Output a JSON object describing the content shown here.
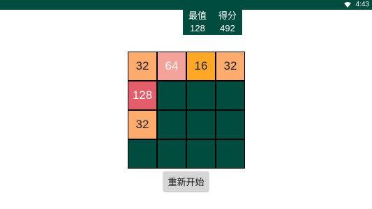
{
  "status_bar": {
    "time": "4:43",
    "icons": [
      "wifi-icon"
    ]
  },
  "scores": {
    "best_label": "最值",
    "best_value": "128",
    "score_label": "得分",
    "score_value": "492"
  },
  "board": {
    "rows": [
      [
        "32",
        "64",
        "16",
        "32"
      ],
      [
        "128",
        "",
        "",
        ""
      ],
      [
        "32",
        "",
        "",
        ""
      ],
      [
        "",
        "",
        "",
        ""
      ]
    ]
  },
  "tile_colors": {
    "empty": "#004d40",
    "16": "#ffa726",
    "32": "#ffab6e",
    "64": "#f4a29a",
    "128": "#e35d6a"
  },
  "tile_text_colors": {
    "16": "#222222",
    "32": "#222222",
    "64": "#ffffff",
    "128": "#ffffff"
  },
  "buttons": {
    "restart_label": "重新开始"
  },
  "colors": {
    "primary_dark": "#004d40",
    "board_line": "#000000"
  }
}
